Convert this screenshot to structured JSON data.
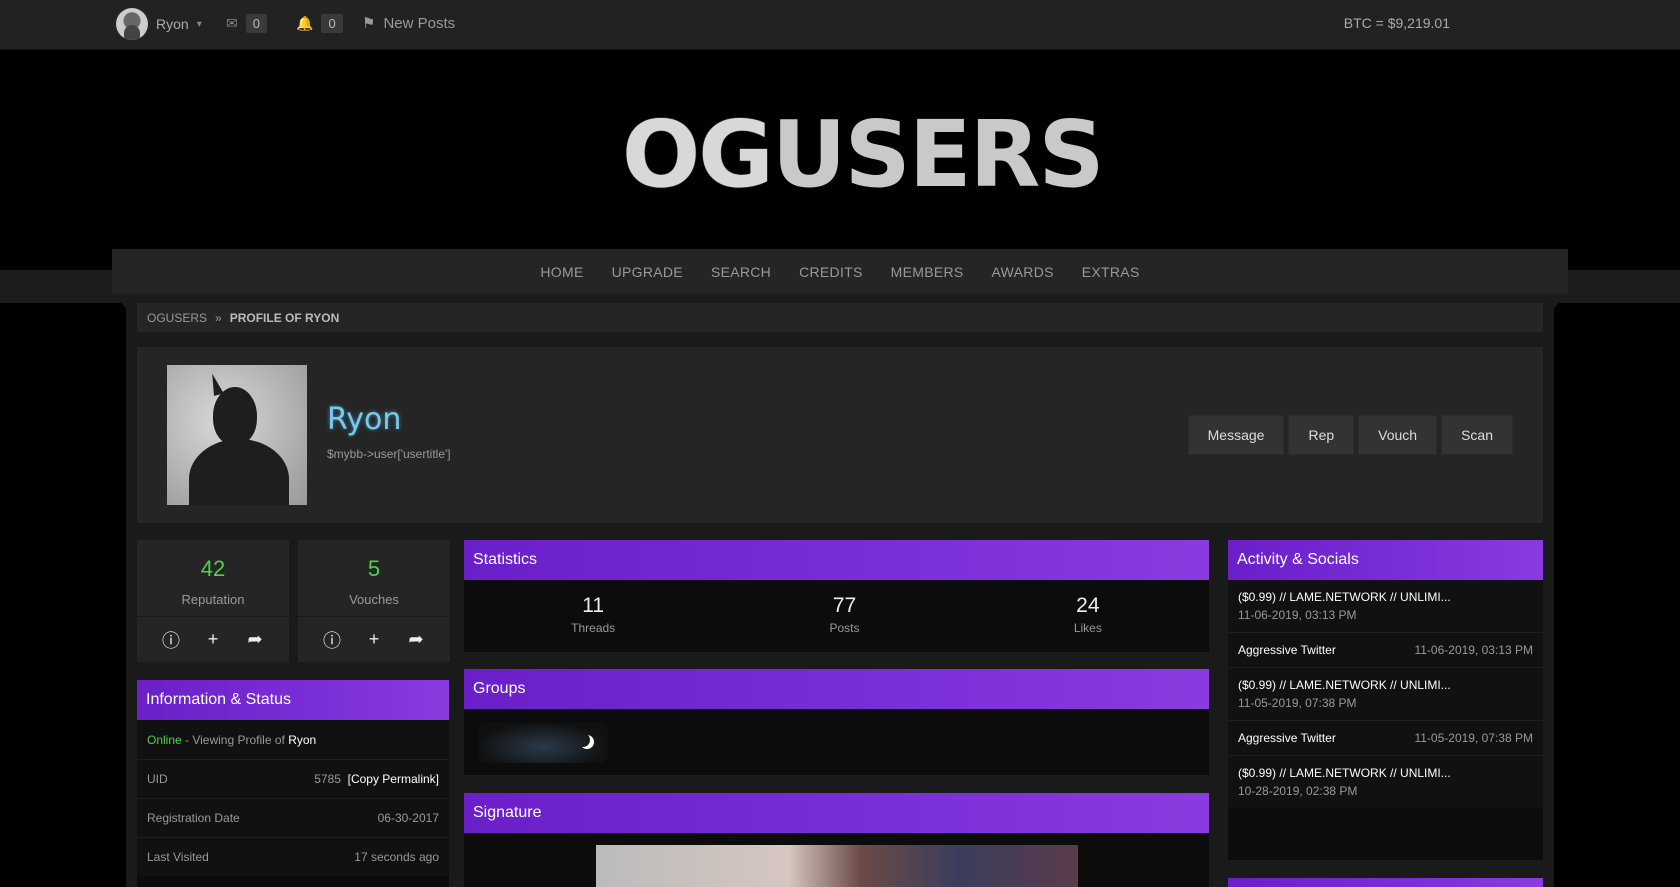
{
  "topbar": {
    "username": "Ryon",
    "messages_count": "0",
    "notifications_count": "0",
    "new_posts_label": "New Posts",
    "btc_price": "BTC = $9,219.01"
  },
  "logo": {
    "text_og": "OG",
    "text_users": "USERS"
  },
  "nav": {
    "items": [
      "HOME",
      "UPGRADE",
      "SEARCH",
      "CREDITS",
      "MEMBERS",
      "AWARDS",
      "EXTRAS"
    ]
  },
  "breadcrumb": {
    "root": "OGUSERS",
    "current": "PROFILE OF RYON"
  },
  "profile": {
    "name": "Ryon",
    "usertitle": "$mybb->user['usertitle']",
    "actions": [
      "Message",
      "Rep",
      "Vouch",
      "Scan"
    ]
  },
  "reputation": {
    "value": "42",
    "label": "Reputation"
  },
  "vouches": {
    "value": "5",
    "label": "Vouches"
  },
  "statistics": {
    "title": "Statistics",
    "items": [
      {
        "value": "11",
        "label": "Threads"
      },
      {
        "value": "77",
        "label": "Posts"
      },
      {
        "value": "24",
        "label": "Likes"
      }
    ]
  },
  "groups": {
    "title": "Groups"
  },
  "signature": {
    "title": "Signature"
  },
  "info": {
    "title": "Information & Status",
    "status_online": "Online",
    "status_text": " - Viewing Profile of ",
    "status_user": "Ryon",
    "uid_label": "UID",
    "uid_value": "5785",
    "permalink": "[Copy Permalink]",
    "reg_label": "Registration Date",
    "reg_value": "06-30-2017",
    "visit_label": "Last Visited",
    "visit_value": "17 seconds ago"
  },
  "activity": {
    "title": "Activity & Socials",
    "items": [
      {
        "title": "($0.99) // LAME.NETWORK // UNLIMI...",
        "date": "11-06-2019, 03:13 PM"
      },
      {
        "title": "Aggressive Twitter",
        "date": "11-06-2019, 03:13 PM"
      },
      {
        "title": "($0.99) // LAME.NETWORK // UNLIMI...",
        "date": "11-05-2019, 07:38 PM"
      },
      {
        "title": "Aggressive Twitter",
        "date": "11-05-2019, 07:38 PM"
      },
      {
        "title": "($0.99) // LAME.NETWORK // UNLIMI...",
        "date": "10-28-2019, 02:38 PM"
      }
    ]
  },
  "colors": {
    "accent_purple": "#7b2fd8",
    "online_green": "#4fd14b",
    "name_blue": "#7cc8e8"
  }
}
